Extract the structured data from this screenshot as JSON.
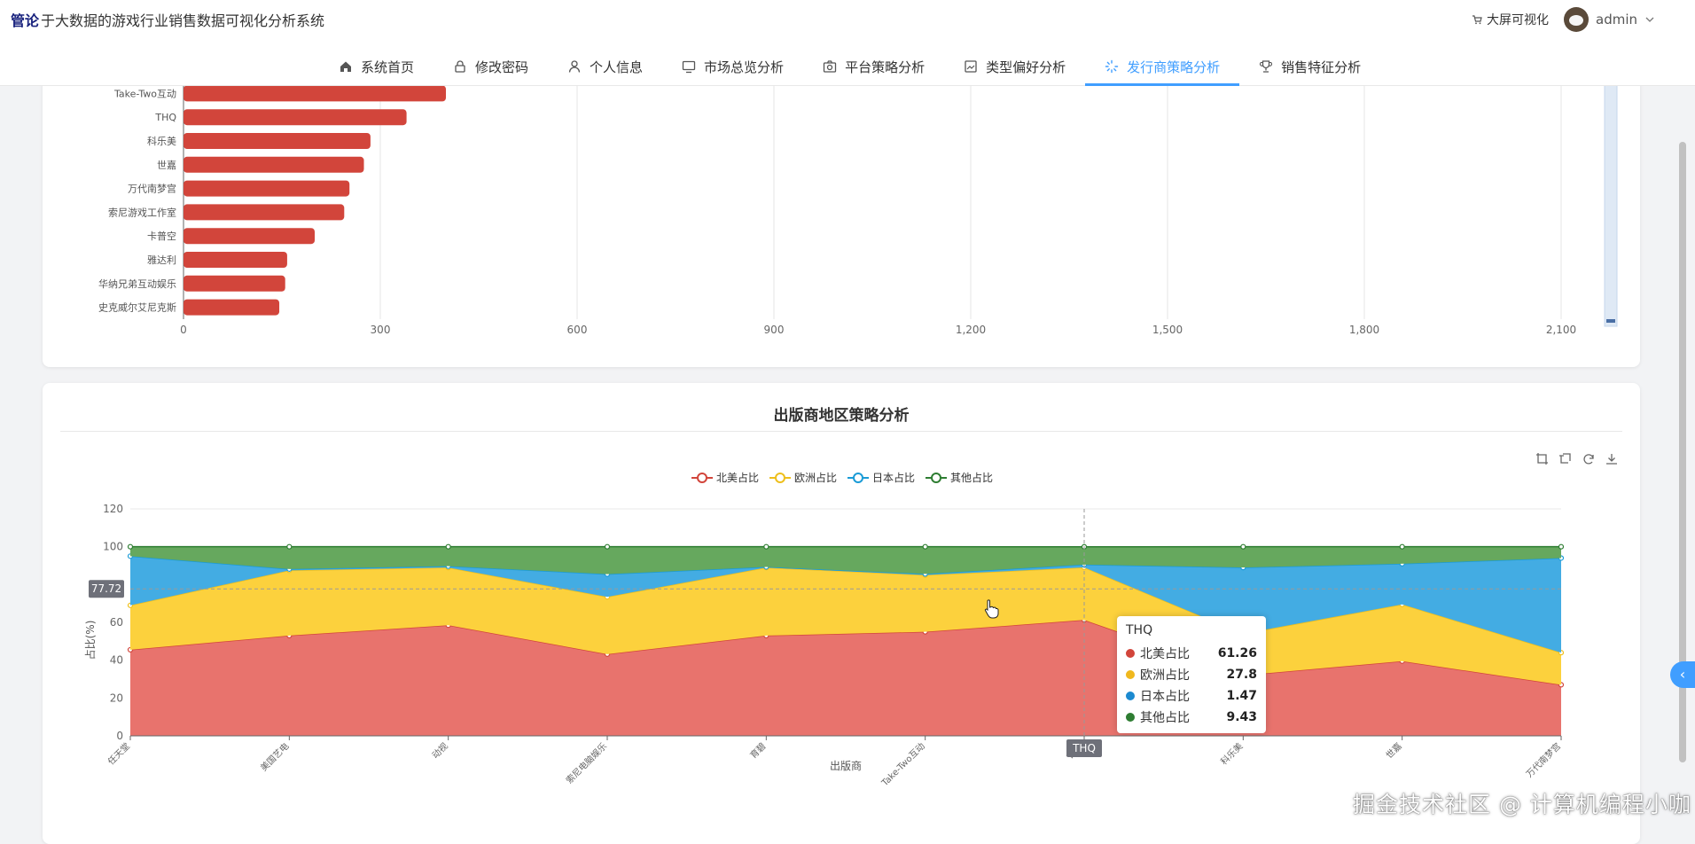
{
  "header": {
    "badge": "管论",
    "title": "于大数据的游戏行业销售数据可视化分析系统",
    "bigscreen_label": "大屏可视化",
    "username": "admin"
  },
  "nav": {
    "items": [
      {
        "label": "系统首页",
        "icon": "home-icon"
      },
      {
        "label": "修改密码",
        "icon": "lock-icon"
      },
      {
        "label": "个人信息",
        "icon": "user-icon"
      },
      {
        "label": "市场总览分析",
        "icon": "monitor-icon"
      },
      {
        "label": "平台策略分析",
        "icon": "camera-icon"
      },
      {
        "label": "类型偏好分析",
        "icon": "picture-icon"
      },
      {
        "label": "发行商策略分析",
        "icon": "loading-icon",
        "active": true
      },
      {
        "label": "销售特征分析",
        "icon": "trophy-icon"
      }
    ]
  },
  "watermark": "掘金技术社区 @ 计算机编程小咖",
  "chart_data": [
    {
      "type": "bar",
      "orientation": "horizontal",
      "categories": [
        "Take-Two互动",
        "THQ",
        "科乐美",
        "世嘉",
        "万代南梦宫",
        "索尼游戏工作室",
        "卡普空",
        "雅达利",
        "华纳兄弟互动娱乐",
        "史克威尔艾尼克斯"
      ],
      "values": [
        400,
        340,
        285,
        275,
        253,
        245,
        200,
        158,
        155,
        146
      ],
      "xlim": [
        0,
        2100
      ],
      "xticks": [
        "0",
        "300",
        "600",
        "900",
        "1,200",
        "1,500",
        "1,800",
        "2,100"
      ],
      "color": "#d2453b"
    },
    {
      "type": "area",
      "stacked": true,
      "title": "出版商地区策略分析",
      "xlabel": "出版商",
      "ylabel": "占比(%)",
      "ylim": [
        0,
        120
      ],
      "yticks": [
        "0",
        "20",
        "40",
        "60",
        "80",
        "100",
        "120"
      ],
      "categories": [
        "任天堂",
        "美国艺电",
        "动视",
        "索尼电脑娱乐",
        "育碧",
        "Take-Two互动",
        "THQ",
        "科乐美",
        "世嘉",
        "万代南梦宫"
      ],
      "series": [
        {
          "name": "北美占比",
          "color": "#d2453b",
          "fill": "#e8736d",
          "values": [
            45.5,
            53,
            58.5,
            43.2,
            53,
            55,
            61.26,
            32,
            39.5,
            27
          ]
        },
        {
          "name": "欧洲占比",
          "color": "#eebf1c",
          "fill": "#fcd13d",
          "values": [
            23.5,
            34.5,
            30.5,
            30.3,
            36,
            30,
            27.8,
            22,
            30,
            17
          ]
        },
        {
          "name": "日本占比",
          "color": "#1a9bd6",
          "fill": "#43ace3",
          "values": [
            26,
            0.7,
            0.7,
            12,
            0.3,
            0.6,
            1.47,
            35,
            21.5,
            50
          ]
        },
        {
          "name": "其他占比",
          "color": "#2e7d32",
          "fill": "#66a85e",
          "values": [
            5,
            11.8,
            10.3,
            14.5,
            10.7,
            14.4,
            9.43,
            11,
            9,
            6
          ]
        }
      ],
      "legend_position": "top-center",
      "crosshair_y_label": "77.72",
      "crosshair_x_label": "THQ",
      "tooltip": {
        "title": "THQ",
        "rows": [
          {
            "label": "北美占比",
            "value": "61.26",
            "color": "#d2453b"
          },
          {
            "label": "欧洲占比",
            "value": "27.8",
            "color": "#f0b81e"
          },
          {
            "label": "日本占比",
            "value": "1.47",
            "color": "#1c8ad0"
          },
          {
            "label": "其他占比",
            "value": "9.43",
            "color": "#2e7d32"
          }
        ]
      }
    }
  ]
}
